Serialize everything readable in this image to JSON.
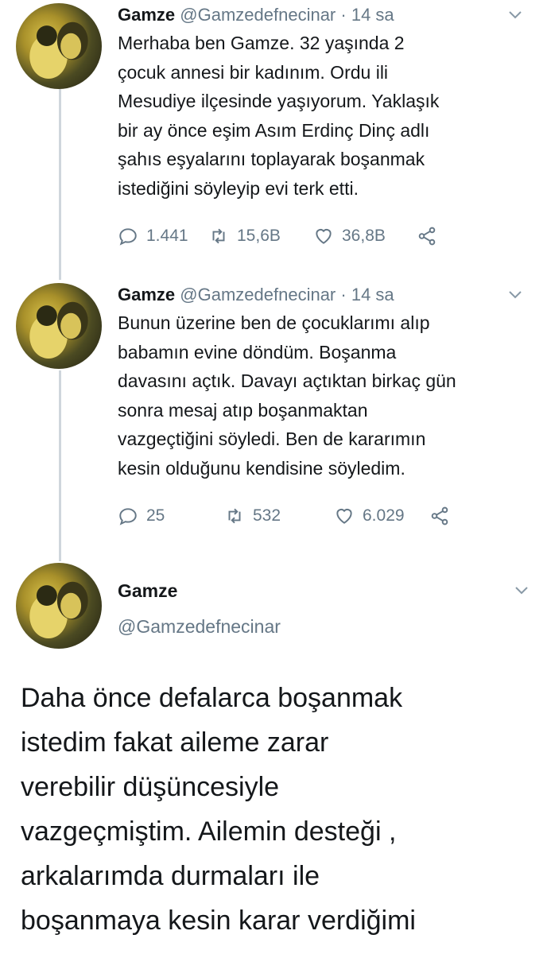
{
  "tweets": [
    {
      "name": "Gamze",
      "handle": "@Gamzedefnecinar",
      "dot": "·",
      "time": "14 sa",
      "lines": [
        "Merhaba ben Gamze. 32 yaşında 2",
        "çocuk annesi bir kadınım. Ordu ili",
        "Mesudiye ilçesinde yaşıyorum. Yaklaşık",
        "bir ay önce eşim Asım Erdinç Dinç adlı",
        "şahıs eşyalarını toplayarak boşanmak",
        "istediğini söyleyip evi terk etti."
      ],
      "replies": "1.441",
      "retweets": "15,6B",
      "likes": "36,8B"
    },
    {
      "name": "Gamze",
      "handle": "@Gamzedefnecinar",
      "dot": "·",
      "time": "14 sa",
      "lines": [
        "Bunun üzerine ben de çocuklarımı alıp",
        "babamın evine döndüm. Boşanma",
        "davasını açtık. Davayı açtıktan birkaç gün",
        "sonra mesaj atıp boşanmaktan",
        "vazgeçtiğini söyledi. Ben de kararımın",
        "kesin olduğunu kendisine söyledim."
      ],
      "replies": "25",
      "retweets": "532",
      "likes": "6.029"
    }
  ],
  "main_tweet": {
    "name": "Gamze",
    "handle": "@Gamzedefnecinar",
    "lines": [
      "Daha önce defalarca boşanmak",
      "istedim fakat aileme zarar",
      "verebilir düşüncesiyle",
      "vazgeçmiştim. Ailemin desteği ,",
      "arkalarımda durmaları ile",
      "boşanmaya kesin karar verdiğimi"
    ]
  },
  "icons": {
    "reply": "reply-icon",
    "retweet": "retweet-icon",
    "like": "heart-icon",
    "share": "share-icon",
    "menu": "chevron-down-icon"
  },
  "colors": {
    "text": "#14171a",
    "muted": "#657786",
    "thread_line": "#cfd6dc"
  }
}
